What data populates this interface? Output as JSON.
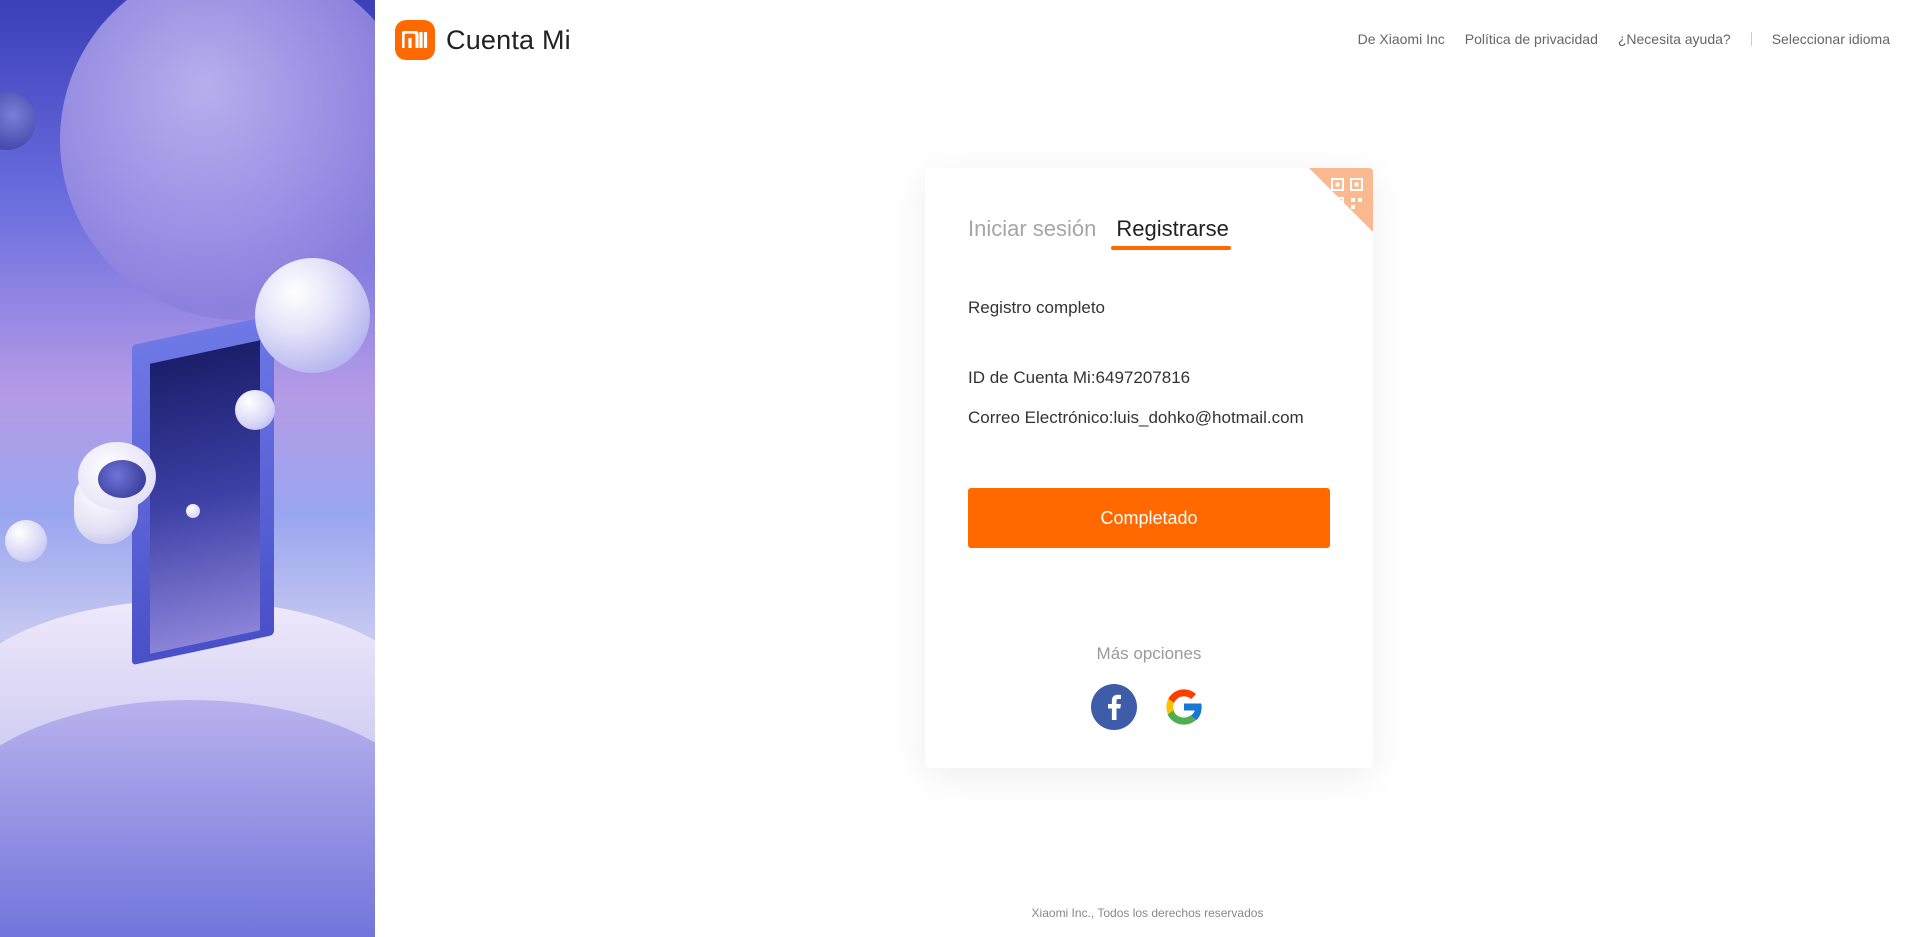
{
  "header": {
    "brand_name": "Cuenta Mi",
    "logo_icon": "mi-logo-icon",
    "links": {
      "about": "De Xiaomi Inc",
      "privacy": "Política de privacidad",
      "help": "¿Necesita ayuda?",
      "language": "Seleccionar idioma"
    }
  },
  "card": {
    "tabs": {
      "login": "Iniciar sesión",
      "register": "Registrarse",
      "active": "register"
    },
    "qr_icon": "qr-code-icon",
    "status": "Registro completo",
    "account_id_line": "ID de Cuenta Mi:6497207816",
    "email_line": "Correo Electrónico:luis_dohko@hotmail.com",
    "done_button": "Completado",
    "more_options": "Más opciones",
    "socials": [
      "facebook-icon",
      "google-icon"
    ]
  },
  "footer": {
    "copyright": "Xiaomi Inc., Todos los derechos reservados"
  },
  "colors": {
    "accent": "#ff6900",
    "facebook": "#3f5ca9",
    "qr_corner": "#fbb98f"
  }
}
